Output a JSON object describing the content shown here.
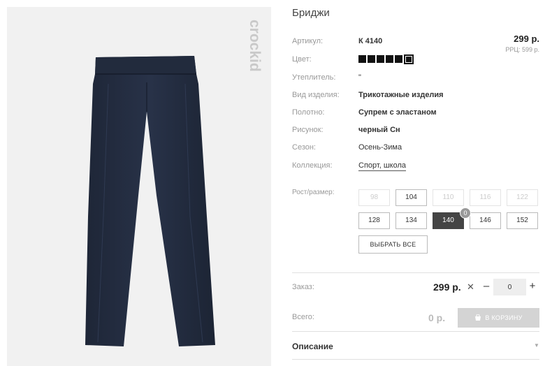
{
  "product": {
    "title": "Бриджи",
    "price": "299 р.",
    "rrp": "РРЦ: 599 р."
  },
  "brand": {
    "logo_text": "crockid"
  },
  "specs": [
    {
      "label": "Артикул:",
      "value": "К 4140"
    },
    {
      "label": "Цвет:",
      "value": ""
    },
    {
      "label": "Утеплитель:",
      "value": "\""
    },
    {
      "label": "Вид изделия:",
      "value": "Трикотажные изделия"
    },
    {
      "label": "Полотно:",
      "value": "Супрем с эластаном"
    },
    {
      "label": "Рисунок:",
      "value": "черный Сн"
    },
    {
      "label": "Сезон:",
      "value": "Осень-Зима"
    },
    {
      "label": "Коллекция:",
      "value": "Спорт, школа"
    }
  ],
  "colors": {
    "swatch_color": "#111111",
    "count": 6,
    "selected_index": 5
  },
  "sizes": {
    "label": "Рост/размер:",
    "items": [
      {
        "label": "98",
        "state": "disabled"
      },
      {
        "label": "104",
        "state": "available"
      },
      {
        "label": "110",
        "state": "disabled"
      },
      {
        "label": "116",
        "state": "disabled"
      },
      {
        "label": "122",
        "state": "disabled"
      },
      {
        "label": "128",
        "state": "available"
      },
      {
        "label": "134",
        "state": "available"
      },
      {
        "label": "140",
        "state": "selected"
      },
      {
        "label": "146",
        "state": "available"
      },
      {
        "label": "152",
        "state": "available"
      }
    ],
    "selected_badge": "0",
    "select_all_label": "ВЫБРАТЬ ВСЕ"
  },
  "order": {
    "label": "Заказ:",
    "price": "299 р.",
    "times": "✕",
    "minus": "–",
    "plus": "+",
    "quantity": "0"
  },
  "total": {
    "label": "Всего:",
    "value": "0 р.",
    "cart_label": "В КОРЗИНУ"
  },
  "description": {
    "label": "Описание",
    "chevron": "▼"
  }
}
